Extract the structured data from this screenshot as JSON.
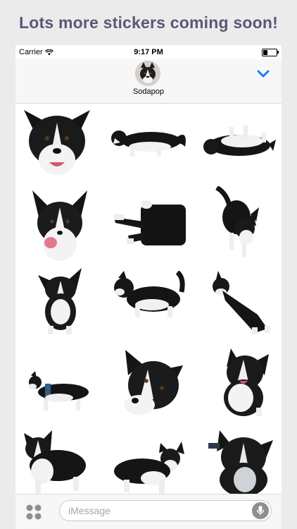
{
  "promo": {
    "title": "Lots more stickers coming soon!"
  },
  "status_bar": {
    "carrier": "Carrier",
    "time": "9:17 PM",
    "wifi_icon": "wifi-icon",
    "battery_icon": "battery-icon"
  },
  "header": {
    "contact_name": "Sodapop",
    "expand_icon": "chevron-down-icon",
    "accent_color": "#1a7cf4"
  },
  "stickers": {
    "row1": [
      "corgi-face-sticker",
      "corgi-lying-sticker",
      "corgi-rolling-sticker"
    ],
    "row2": [
      "corgi-tongue-sticker",
      "corgi-stretch-sticker",
      "corgi-walking-sticker"
    ],
    "row3": [
      "corgi-sitting-sticker",
      "corgi-side-sticker",
      "corgi-leaping-sticker"
    ],
    "row4": [
      "corgi-harness-sticker",
      "corgi-headtilt-sticker",
      "corgi-lookup-sticker"
    ],
    "row5": [
      "corgi-stand-sticker",
      "corgi-standing-side-sticker",
      "corgi-portrait-sticker"
    ]
  },
  "composer": {
    "placeholder": "iMessage",
    "apps_icon": "app-grid-icon",
    "mic_icon": "microphone-icon"
  }
}
